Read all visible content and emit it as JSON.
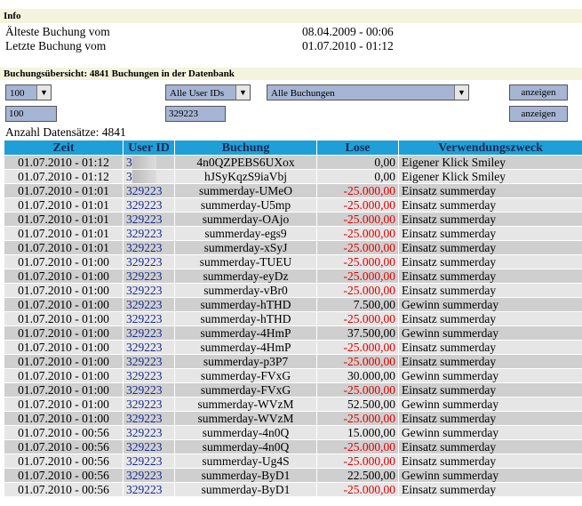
{
  "info": {
    "heading": "Info",
    "rows": [
      {
        "label": "Älteste Buchung vom",
        "value": "08.04.2009 - 00:06"
      },
      {
        "label": "Letzte Buchung vom",
        "value": "01.07.2010 - 01:12"
      }
    ]
  },
  "overview": {
    "heading": "Buchungsübersicht: 4841 Buchungen in der Datenbank"
  },
  "filters": {
    "limit_select": "100",
    "user_select": "Alle User IDs",
    "booking_select": "Alle Buchungen",
    "show_button": "anzeigen",
    "limit_input": "100",
    "user_input": "329223",
    "show_button_2": "anzeigen"
  },
  "count_label": "Anzahl Datensätze: 4841",
  "table": {
    "headers": [
      "Zeit",
      "User ID",
      "Buchung",
      "Lose",
      "Verwendungszweck"
    ],
    "rows": [
      {
        "time": "01.07.2010 - 01:12",
        "uid": "3",
        "booking": "4n0QZPEBS6UXox",
        "lose": "0,00",
        "purpose": "Eigener Klick Smiley",
        "neg": false,
        "blur": true
      },
      {
        "time": "01.07.2010 - 01:12",
        "uid": "3",
        "booking": "hJSyKqzS9iaVbj",
        "lose": "0,00",
        "purpose": "Eigener Klick Smiley",
        "neg": false,
        "blur": true
      },
      {
        "time": "01.07.2010 - 01:01",
        "uid": "329223",
        "booking": "summerday-UMeO",
        "lose": "-25.000,00",
        "purpose": "Einsatz summerday",
        "neg": true
      },
      {
        "time": "01.07.2010 - 01:01",
        "uid": "329223",
        "booking": "summerday-U5mp",
        "lose": "-25.000,00",
        "purpose": "Einsatz summerday",
        "neg": true
      },
      {
        "time": "01.07.2010 - 01:01",
        "uid": "329223",
        "booking": "summerday-OAjo",
        "lose": "-25.000,00",
        "purpose": "Einsatz summerday",
        "neg": true
      },
      {
        "time": "01.07.2010 - 01:01",
        "uid": "329223",
        "booking": "summerday-egs9",
        "lose": "-25.000,00",
        "purpose": "Einsatz summerday",
        "neg": true
      },
      {
        "time": "01.07.2010 - 01:01",
        "uid": "329223",
        "booking": "summerday-xSyJ",
        "lose": "-25.000,00",
        "purpose": "Einsatz summerday",
        "neg": true
      },
      {
        "time": "01.07.2010 - 01:00",
        "uid": "329223",
        "booking": "summerday-TUEU",
        "lose": "-25.000,00",
        "purpose": "Einsatz summerday",
        "neg": true
      },
      {
        "time": "01.07.2010 - 01:00",
        "uid": "329223",
        "booking": "summerday-eyDz",
        "lose": "-25.000,00",
        "purpose": "Einsatz summerday",
        "neg": true
      },
      {
        "time": "01.07.2010 - 01:00",
        "uid": "329223",
        "booking": "summerday-vBr0",
        "lose": "-25.000,00",
        "purpose": "Einsatz summerday",
        "neg": true
      },
      {
        "time": "01.07.2010 - 01:00",
        "uid": "329223",
        "booking": "summerday-hTHD",
        "lose": "7.500,00",
        "purpose": "Gewinn summerday",
        "neg": false
      },
      {
        "time": "01.07.2010 - 01:00",
        "uid": "329223",
        "booking": "summerday-hTHD",
        "lose": "-25.000,00",
        "purpose": "Einsatz summerday",
        "neg": true
      },
      {
        "time": "01.07.2010 - 01:00",
        "uid": "329223",
        "booking": "summerday-4HmP",
        "lose": "37.500,00",
        "purpose": "Gewinn summerday",
        "neg": false
      },
      {
        "time": "01.07.2010 - 01:00",
        "uid": "329223",
        "booking": "summerday-4HmP",
        "lose": "-25.000,00",
        "purpose": "Einsatz summerday",
        "neg": true
      },
      {
        "time": "01.07.2010 - 01:00",
        "uid": "329223",
        "booking": "summerday-p3P7",
        "lose": "-25.000,00",
        "purpose": "Einsatz summerday",
        "neg": true
      },
      {
        "time": "01.07.2010 - 01:00",
        "uid": "329223",
        "booking": "summerday-FVxG",
        "lose": "30.000,00",
        "purpose": "Gewinn summerday",
        "neg": false
      },
      {
        "time": "01.07.2010 - 01:00",
        "uid": "329223",
        "booking": "summerday-FVxG",
        "lose": "-25.000,00",
        "purpose": "Einsatz summerday",
        "neg": true
      },
      {
        "time": "01.07.2010 - 01:00",
        "uid": "329223",
        "booking": "summerday-WVzM",
        "lose": "52.500,00",
        "purpose": "Gewinn summerday",
        "neg": false
      },
      {
        "time": "01.07.2010 - 01:00",
        "uid": "329223",
        "booking": "summerday-WVzM",
        "lose": "-25.000,00",
        "purpose": "Einsatz summerday",
        "neg": true
      },
      {
        "time": "01.07.2010 - 00:56",
        "uid": "329223",
        "booking": "summerday-4n0Q",
        "lose": "15.000,00",
        "purpose": "Gewinn summerday",
        "neg": false
      },
      {
        "time": "01.07.2010 - 00:56",
        "uid": "329223",
        "booking": "summerday-4n0Q",
        "lose": "-25.000,00",
        "purpose": "Einsatz summerday",
        "neg": true
      },
      {
        "time": "01.07.2010 - 00:56",
        "uid": "329223",
        "booking": "summerday-Ug4S",
        "lose": "-25.000,00",
        "purpose": "Einsatz summerday",
        "neg": true
      },
      {
        "time": "01.07.2010 - 00:56",
        "uid": "329223",
        "booking": "summerday-ByD1",
        "lose": "22.500,00",
        "purpose": "Gewinn summerday",
        "neg": false
      },
      {
        "time": "01.07.2010 - 00:56",
        "uid": "329223",
        "booking": "summerday-ByD1",
        "lose": "-25.000,00",
        "purpose": "Einsatz summerday",
        "neg": true
      }
    ]
  }
}
